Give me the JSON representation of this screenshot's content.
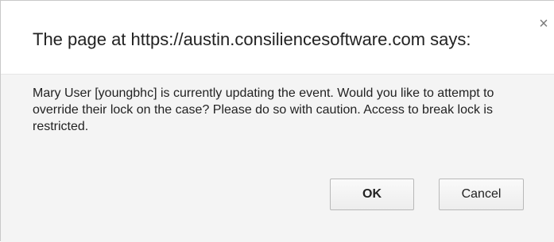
{
  "dialog": {
    "title": "The page at https://austin.consiliencesoftware.com says:",
    "close_icon": "×",
    "message": "Mary User [youngbhc] is currently updating the event.  Would you like to attempt to override their lock on the case?  Please do so with caution. Access to break lock is restricted.",
    "ok_label": "OK",
    "cancel_label": "Cancel"
  }
}
